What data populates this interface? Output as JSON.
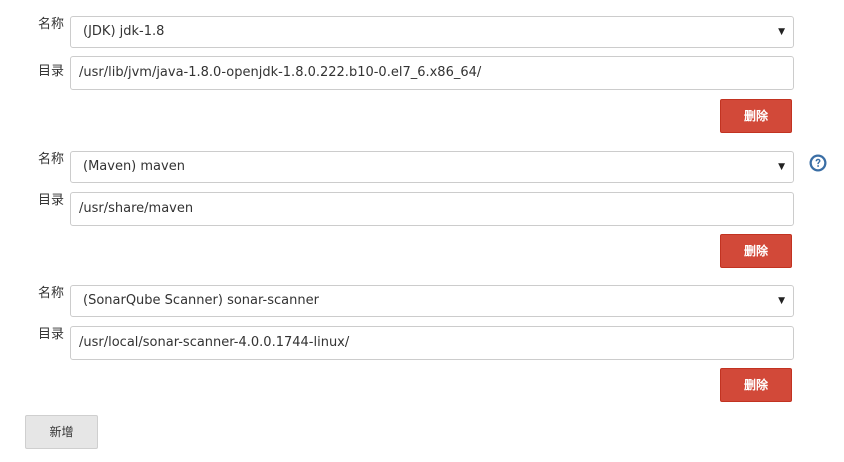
{
  "tools": [
    {
      "name_label": "名称",
      "name_value": "(JDK) jdk-1.8",
      "dir_label": "目录",
      "dir_value": "/usr/lib/jvm/java-1.8.0-openjdk-1.8.0.222.b10-0.el7_6.x86_64/",
      "delete_label": "删除"
    },
    {
      "name_label": "名称",
      "name_value": "(Maven) maven",
      "dir_label": "目录",
      "dir_value": "/usr/share/maven",
      "delete_label": "删除"
    },
    {
      "name_label": "名称",
      "name_value": "(SonarQube Scanner) sonar-scanner",
      "dir_label": "目录",
      "dir_value": "/usr/local/sonar-scanner-4.0.0.1744-linux/",
      "delete_label": "删除"
    }
  ],
  "add_label": "新增",
  "icons": {
    "dropdown": "▼",
    "help": "question-circle"
  },
  "colors": {
    "delete_button": "#d24939",
    "add_button": "#e6e6e6",
    "help_icon": "#3a6ea5"
  }
}
